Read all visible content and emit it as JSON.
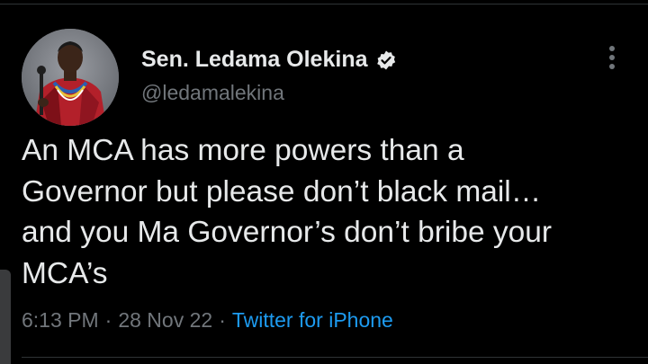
{
  "author": {
    "name": "Sen. Ledama Olekina",
    "handle": "@ledamalekina",
    "verified": true,
    "verified_color": "#e7e9ea",
    "avatar_icon": "profile-photo"
  },
  "tweet": {
    "lines": [
      "An MCA has more powers than a",
      "Governor but please don’t black mail…",
      "and you Ma Governor’s don’t bribe your",
      "MCA’s"
    ]
  },
  "meta": {
    "time": "6:13 PM",
    "separator": "·",
    "date": "28 Nov 22",
    "source": "Twitter for iPhone",
    "source_color": "#1d9bf0"
  },
  "icons": {
    "more": "more-options-icon",
    "verified": "verified-badge-icon"
  },
  "colors": {
    "background": "#000000",
    "primary_text": "#e7e9ea",
    "secondary_text": "#71767b",
    "accent": "#1d9bf0"
  }
}
